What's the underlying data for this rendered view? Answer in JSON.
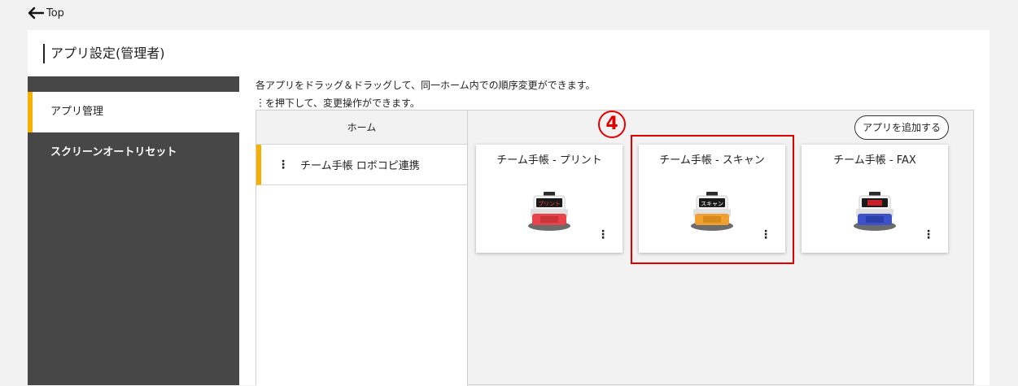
{
  "nav": {
    "back_label": "Top",
    "back_icon": "arrow-left-icon"
  },
  "page": {
    "title": "アプリ設定(管理者)"
  },
  "sidebar": {
    "items": [
      {
        "label": "アプリ管理",
        "active": true
      },
      {
        "label": "スクリーンオートリセット",
        "active": false
      }
    ]
  },
  "description": {
    "line1": "各アプリをドラッグ＆ドラッグして、同一ホーム内での順序変更ができます。",
    "line2": "︙を押下して、変更操作ができます。"
  },
  "home": {
    "header": "ホーム",
    "items": [
      {
        "label": "チーム手帳 ロボコピ連携",
        "menu": "⋮"
      }
    ]
  },
  "apps": {
    "add_button": "アプリを追加する",
    "cards": [
      {
        "title": "チーム手帳 - プリント",
        "menu": "⋮",
        "color": "#e8434a",
        "screen_color": "#1a1a1a"
      },
      {
        "title": "チーム手帳 - スキャン",
        "menu": "⋮",
        "color": "#f0a030",
        "screen_color": "#1a1a1a"
      },
      {
        "title": "チーム手帳 - FAX",
        "menu": "⋮",
        "color": "#3d52c8",
        "screen_color": "#c81e2a"
      }
    ]
  },
  "annotation": {
    "step": "4",
    "color": "#e00000"
  },
  "colors": {
    "accent": "#f5b000",
    "sidebar_bg": "#474747"
  }
}
